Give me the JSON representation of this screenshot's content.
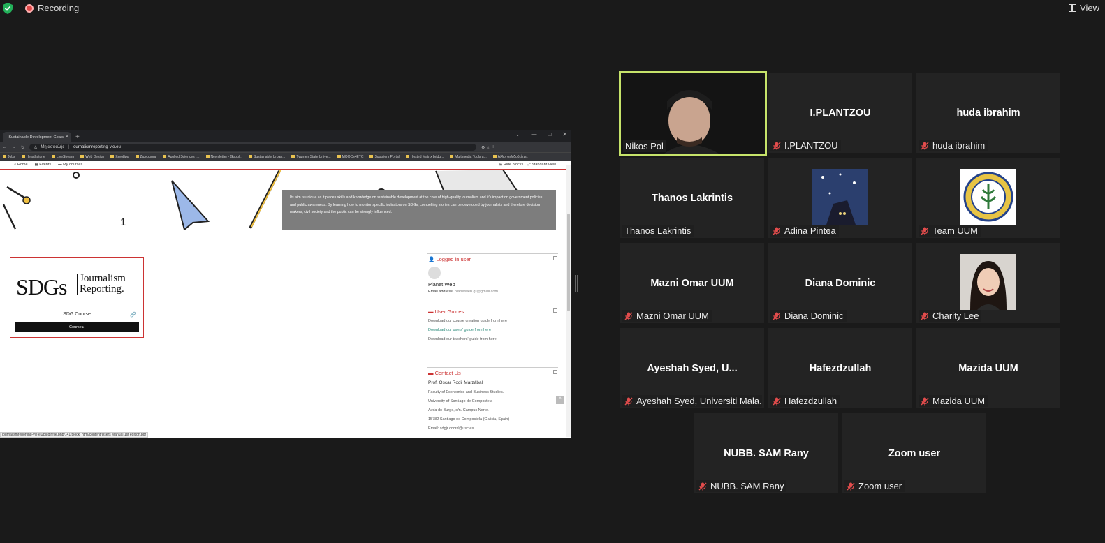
{
  "topbar": {
    "recording_label": "Recording",
    "view_label": "View"
  },
  "browser": {
    "tab_title": "Sustainable Development Goals",
    "address_prefix": "Μη ασφαλής",
    "address_url": "journalismreporting-vle.eu",
    "bookmarks": [
      "Jobs",
      "Hearthstone",
      "LiveStream",
      "Web Design",
      "Ξενόβρα",
      "Ζωγραφής",
      "Applied Sciences |...",
      "Newsletter - Googl...",
      "Sustainable Urban...",
      "Tyumen State Unive...",
      "MOOCs4ETC",
      "Suppliers Portal",
      "Hosted Matrix bridg...",
      "Multimedia Tools a...",
      "Άλλοι σελιδοδείκτες"
    ],
    "status_url": "journalismreporting-vle.eu/pluginfile.php/141/block_html/content/Users Manual 1st edition.pdf"
  },
  "site": {
    "nav": {
      "home": "Home",
      "events": "Events",
      "my_courses": "My courses",
      "hide_blocks": "Hide blocks",
      "standard_view": "Standard view"
    },
    "hero_text": "Its aim is unique as it places skills and knowledge on sustainable development at the core of high-quality journalism and it's impact on government policies and public awareness. By learning how to monitor specific indicators on SDGs, compelling stories can be developed by journalists and therefore decision makers, civil society and the public can be strongly influenced.",
    "course": {
      "logo_main": "SDGs",
      "logo_line1": "Journalism",
      "logo_line2": "Reporting.",
      "name": "SDG Course",
      "button": "Course ▸"
    },
    "logged_in": {
      "title": "Logged in user",
      "user": "Planet Web",
      "email_label": "Email address:",
      "email": "planetweb.gr@gmail.com"
    },
    "guides": {
      "title": "User Guides",
      "items": [
        "Download our course creation guide from here",
        "Download our users' guide from here",
        "Download our teachers' guide from here"
      ]
    },
    "contact": {
      "title": "Contact Us",
      "name": "Prof. Óscar Rodil Marzábal",
      "lines": [
        "Faculty of Economics and Business Studies.",
        "University of Santiago de Compostela",
        "Avda do Burgo, s/n. Campus Norte.",
        "15782 Santiago de Compostela (Galicia, Spain)",
        "Email: sdgjr.coord@usc.es"
      ]
    }
  },
  "participants": [
    {
      "display": "",
      "label": "Nikos Pol",
      "muted": false,
      "video": true
    },
    {
      "display": "I.PLANTZOU",
      "label": "I.PLANTZOU",
      "muted": true
    },
    {
      "display": "huda ibrahim",
      "label": "huda ibrahim",
      "muted": true
    },
    {
      "display": "Thanos Lakrintis",
      "label": "Thanos Lakrintis",
      "muted": false
    },
    {
      "display": "",
      "label": "Adina Pintea",
      "muted": true,
      "avatar": "painting"
    },
    {
      "display": "",
      "label": "Team UUM",
      "muted": true,
      "avatar": "uum-seal"
    },
    {
      "display": "Mazni Omar UUM",
      "label": "Mazni Omar UUM",
      "muted": true
    },
    {
      "display": "Diana Dominic",
      "label": "Diana Dominic",
      "muted": true
    },
    {
      "display": "",
      "label": "Charity Lee",
      "muted": true,
      "avatar": "photo"
    },
    {
      "display": "Ayeshah Syed, U...",
      "label": "Ayeshah Syed, Universiti Mala...",
      "muted": true
    },
    {
      "display": "Hafezdzullah",
      "label": "Hafezdzullah",
      "muted": true
    },
    {
      "display": "Mazida UUM",
      "label": "Mazida UUM",
      "muted": true
    },
    {
      "display": "NUBB. SAM Rany",
      "label": "NUBB. SAM Rany",
      "muted": true
    },
    {
      "display": "Zoom user",
      "label": "Zoom user",
      "muted": true
    }
  ]
}
